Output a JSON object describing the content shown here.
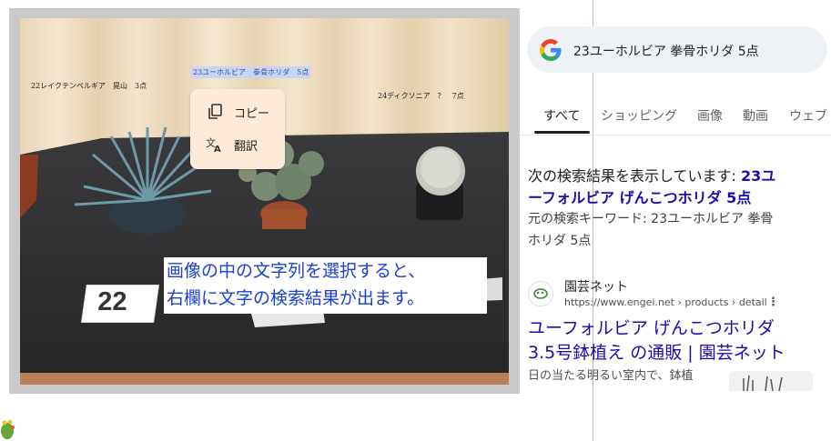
{
  "photo": {
    "labels": {
      "label_22": "22レイクテンペルギア　晃山　3点",
      "label_23": "23ユーホルビア　拳骨ホリダ　5点",
      "label_24": "24ディクソニア　？　7点"
    },
    "tag_number": "22"
  },
  "context_menu": {
    "copy_label": "コピー",
    "translate_label": "翻訳"
  },
  "caption": {
    "line1": "画像の中の文字列を選択すると、",
    "line2": "右欄に文字の検索結果が出ます。"
  },
  "search": {
    "query": "23ユーホルビア 拳骨ホリダ 5点",
    "tabs": [
      "すべて",
      "ショッピング",
      "画像",
      "動画",
      "ウェブ"
    ],
    "active_tab": "すべて"
  },
  "results": {
    "showing_prefix": "次の検索結果を表示しています: ",
    "showing_query_1": "23ユ",
    "showing_query_2": "ーフォルビア げんこつホリダ 5点",
    "original_line1": "元の検索キーワード: 23ユーホルビア 拳骨",
    "original_line2": "ホリダ 5点",
    "site_name": "園芸ネット",
    "site_url": "https://www.engei.net › products › detail",
    "title_line1": "ユーフォルビア げんこつホリダ",
    "title_line2": "3.5号鉢植え の通販 | 園芸ネット",
    "snippet": "日の当たる明るい室内で、鉢植"
  },
  "colors": {
    "caption_text": "#1a3fd1",
    "link_blue": "#1a0dab",
    "menu_bg": "#fdebd7",
    "search_bg": "#eef1f6"
  },
  "icons": [
    "google-logo",
    "copy-icon",
    "translate-icon",
    "more-vert-icon",
    "engei-site-icon",
    "cactus-icon"
  ]
}
